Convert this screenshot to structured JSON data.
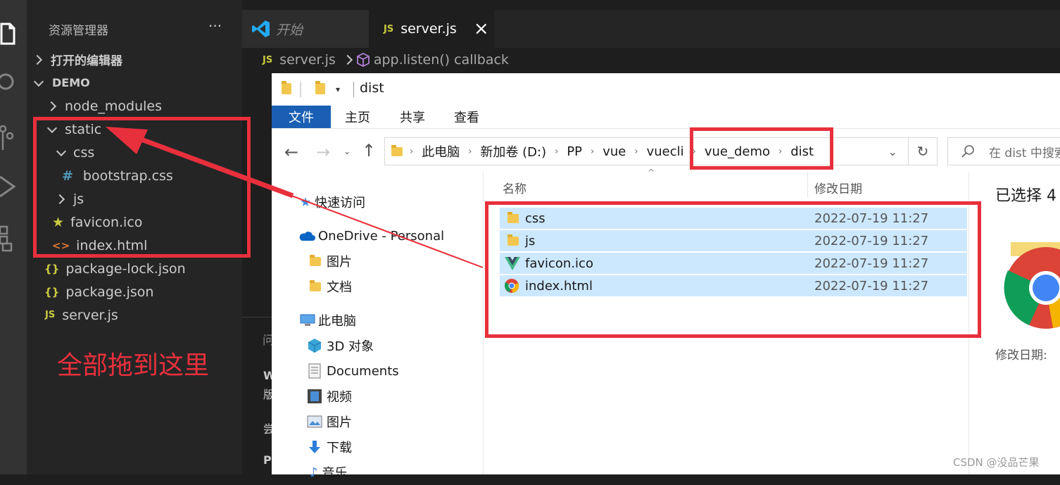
{
  "vscode": {
    "sidebar_title": "资源管理器",
    "more": "···",
    "open_editors": "打开的编辑器",
    "workspace": "DEMO",
    "tree": [
      {
        "label": "node_modules",
        "kind": "folder-closed",
        "icon": "chevron-right-icon"
      },
      {
        "label": "static",
        "kind": "folder-open",
        "icon": "chevron-down-icon"
      },
      {
        "label": "css",
        "kind": "folder-open",
        "icon": "chevron-down-icon"
      },
      {
        "label": "bootstrap.css",
        "kind": "css-file",
        "icon": "#"
      },
      {
        "label": "js",
        "kind": "folder-closed",
        "icon": "chevron-right-icon"
      },
      {
        "label": "favicon.ico",
        "kind": "star-file",
        "icon": "★"
      },
      {
        "label": "index.html",
        "kind": "html-file",
        "icon": "<>"
      },
      {
        "label": "package-lock.json",
        "kind": "json-file",
        "icon": "{}"
      },
      {
        "label": "package.json",
        "kind": "json-file",
        "icon": "{}"
      },
      {
        "label": "server.js",
        "kind": "js-file",
        "icon": "JS"
      }
    ],
    "tabs": [
      {
        "label": "开始",
        "icon": "vscode-logo-icon"
      },
      {
        "label": "server.js",
        "icon": "JS"
      }
    ],
    "tab_close": "×",
    "breadcrumb": {
      "file": "server.js",
      "icon": "JS",
      "symbol": "app.listen() callback"
    },
    "annotation": "全部拖到这里",
    "annotation_color": "#e8303c",
    "bottom_panel_fragments": [
      "问",
      "W",
      "版",
      "尝",
      "P"
    ]
  },
  "explorer": {
    "title": "dist",
    "ribbon_tabs": [
      "文件",
      "主页",
      "共享",
      "查看"
    ],
    "address": [
      "此电脑",
      "新加卷 (D:)",
      "PP",
      "vue",
      "vuecli",
      "vue_demo",
      "dist"
    ],
    "search_placeholder": "在 dist 中搜索",
    "nav": [
      {
        "label": "快速访问",
        "icon": "star-icon"
      },
      {
        "label": "OneDrive - Personal",
        "icon": "cloud-icon"
      },
      {
        "label": "图片",
        "icon": "folder-icon"
      },
      {
        "label": "文档",
        "icon": "folder-icon"
      },
      {
        "label": "此电脑",
        "icon": "computer-icon"
      },
      {
        "label": "3D 对象",
        "icon": "cube-icon"
      },
      {
        "label": "Documents",
        "icon": "document-icon"
      },
      {
        "label": "视频",
        "icon": "film-icon"
      },
      {
        "label": "图片",
        "icon": "picture-icon"
      },
      {
        "label": "下载",
        "icon": "download-arrow-icon"
      },
      {
        "label": "音乐",
        "icon": "music-icon"
      }
    ],
    "columns": {
      "name": "名称",
      "date": "修改日期"
    },
    "files": [
      {
        "name": "css",
        "date": "2022-07-19 11:27",
        "icon": "folder-icon"
      },
      {
        "name": "js",
        "date": "2022-07-19 11:27",
        "icon": "folder-icon"
      },
      {
        "name": "favicon.ico",
        "date": "2022-07-19 11:27",
        "icon": "vue-icon"
      },
      {
        "name": "index.html",
        "date": "2022-07-19 11:27",
        "icon": "chrome-icon"
      }
    ],
    "details_title": "已选择 4",
    "details_date_label": "修改日期:",
    "watermark": "CSDN @没品芒果"
  },
  "colors": {
    "vscode_bg": "#1e1e1e",
    "sidebar_bg": "#252526",
    "selection": "#cce8ff",
    "ribbon_file": "#1a5fb4",
    "highlight_red": "#e8303c"
  }
}
